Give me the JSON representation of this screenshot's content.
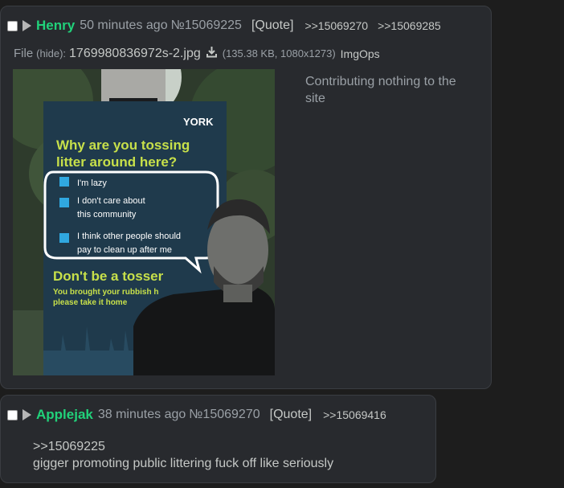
{
  "posts": [
    {
      "name": "Henry",
      "time": "50 minutes ago",
      "post_number": "№15069225",
      "quote_label": "[Quote]",
      "backlinks": [
        ">>15069270",
        ">>15069285"
      ],
      "file": {
        "label": "File",
        "hide_label": "(hide):",
        "filename": "1769980836972s-2.jpg",
        "meta": "(135.38 KB, 1080x1273)",
        "imgops": "ImgOps",
        "image": {
          "sign_logo": "YORK",
          "sign_question": "Why are you tossing litter around here?",
          "checkbox_items": [
            "I'm lazy",
            "I don't care about this community",
            "I think other people should pay to clean up after me"
          ],
          "sign_slogan": "Don't be a tosser",
          "sign_footer": "You brought your rubbish here please take it home"
        }
      },
      "comment": "Contributing nothing to the site"
    },
    {
      "name": "Applejak",
      "time": "38 minutes ago",
      "post_number": "№15069270",
      "quote_label": "[Quote]",
      "backlinks": [
        ">>15069416"
      ],
      "comment_quotelink": ">>15069225",
      "comment": "gigger promoting public littering fuck off like seriously"
    }
  ],
  "colors": {
    "background": "#1d1d1d",
    "post_background": "#282a2e",
    "name_green": "#21d17a",
    "muted_text": "#9aa0a6",
    "text": "#c5c8c6"
  },
  "icons": [
    "checkbox-icon",
    "post-menu-triangle-icon",
    "download-icon"
  ]
}
